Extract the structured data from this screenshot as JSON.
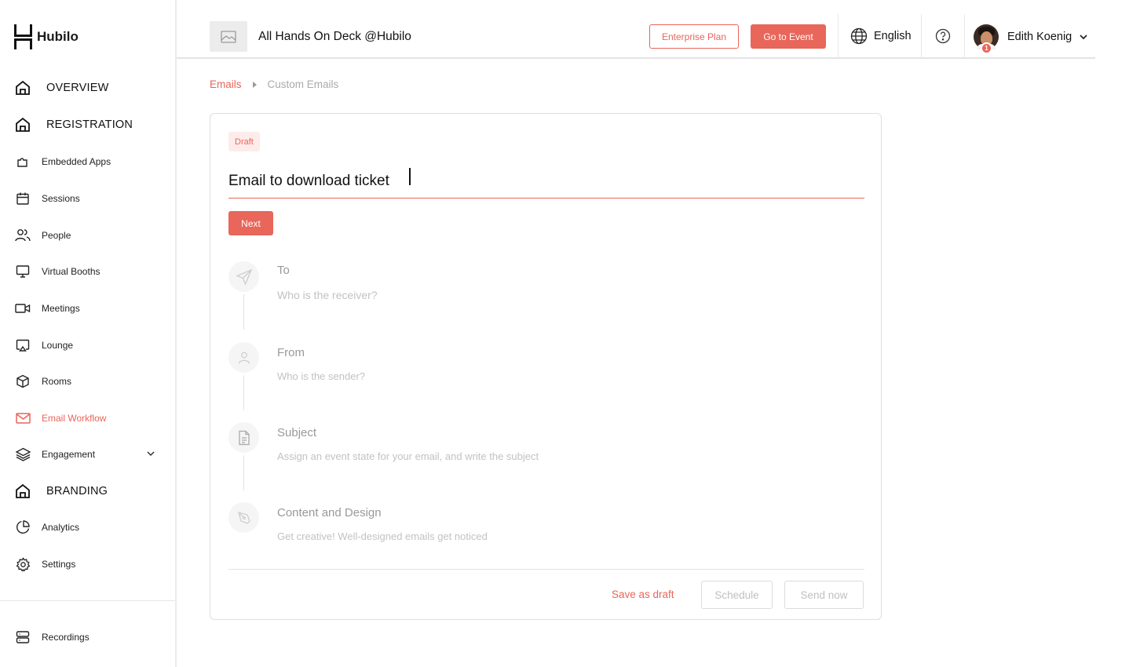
{
  "brand": {
    "name": "Hubilo"
  },
  "sidebar": {
    "items": [
      {
        "label": "OVERVIEW",
        "icon": "home-icon",
        "section": true
      },
      {
        "label": "REGISTRATION",
        "icon": "home-icon",
        "section": true
      },
      {
        "label": "Embedded Apps",
        "icon": "puzzle-icon"
      },
      {
        "label": "Sessions",
        "icon": "calendar-icon"
      },
      {
        "label": "People",
        "icon": "people-icon"
      },
      {
        "label": "Virtual Booths",
        "icon": "monitor-icon"
      },
      {
        "label": "Meetings",
        "icon": "video-icon"
      },
      {
        "label": "Lounge",
        "icon": "cast-icon"
      },
      {
        "label": "Rooms",
        "icon": "cube-icon"
      },
      {
        "label": "Email Workflow",
        "icon": "mail-icon",
        "active": true
      },
      {
        "label": "Engagement",
        "icon": "layers-icon",
        "expandable": true
      },
      {
        "label": "BRANDING",
        "icon": "home-icon",
        "section": true
      },
      {
        "label": "Analytics",
        "icon": "pie-chart-icon"
      },
      {
        "label": "Settings",
        "icon": "gear-icon"
      },
      {
        "label": "Recordings",
        "icon": "server-icon"
      }
    ]
  },
  "header": {
    "event_title": "All Hands On Deck @Hubilo",
    "plan_button": "Enterprise Plan",
    "go_button": "Go to Event",
    "language": "English",
    "user_name": "Edith Koenig",
    "avatar_badge": "1"
  },
  "breadcrumb": {
    "parent": "Emails",
    "current": "Custom Emails"
  },
  "editor": {
    "status": "Draft",
    "title_value": "Email to download ticket ",
    "next_button": "Next",
    "steps": [
      {
        "title": "To",
        "subtitle": "Who is the receiver?",
        "icon": "send-icon"
      },
      {
        "title": "From",
        "subtitle": "Who is the sender?",
        "icon": "user-icon"
      },
      {
        "title": "Subject",
        "subtitle": "Assign an event state for your email, and write the subject",
        "icon": "document-icon"
      },
      {
        "title": "Content and Design",
        "subtitle": "Get creative! Well-designed emails get noticed",
        "icon": "pen-tool-icon"
      }
    ],
    "save_draft": "Save as draft",
    "schedule": "Schedule",
    "send_now": "Send now"
  },
  "colors": {
    "accent": "#e8665a",
    "accent_light": "#fdecea"
  }
}
